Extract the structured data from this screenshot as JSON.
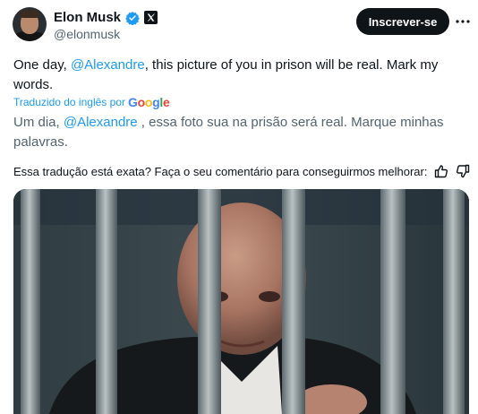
{
  "author": {
    "display_name": "Elon Musk",
    "handle": "@elonmusk"
  },
  "actions": {
    "subscribe_label": "Inscrever-se"
  },
  "tweet": {
    "text_before": "One day, ",
    "mention": "@Alexandre",
    "text_after": ", this picture of you in prison will be real. Mark my words."
  },
  "translation": {
    "translated_by": "Traduzido do inglês por",
    "provider": "Google",
    "text_before": "Um dia, ",
    "mention": "@Alexandre",
    "text_after": " , essa foto sua na prisão será real. Marque minhas palavras.",
    "feedback_prompt": "Essa tradução está exata? Faça o seu comentário para conseguirmos melhorar:"
  },
  "colors": {
    "accent": "#1d9bf0",
    "verified": "#1d9bf0",
    "text_primary": "#0f1419",
    "text_secondary": "#536471"
  },
  "icons": {
    "verified": "verified-badge-icon",
    "brand": "x-logo-icon",
    "more": "more-options-icon",
    "like_translation": "thumbs-up-icon",
    "dislike_translation": "thumbs-down-icon"
  }
}
